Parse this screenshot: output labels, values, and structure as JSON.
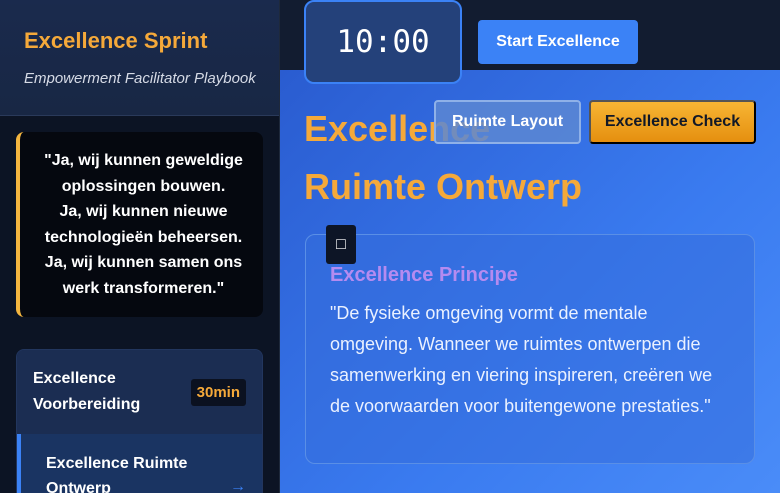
{
  "sidebar": {
    "title": "Excellence Sprint",
    "subtitle": "Empowerment Facilitator Playbook",
    "quote": "\"Ja, wij kunnen geweldige\noplossingen bouwen.\nJa, wij kunnen nieuwe\ntechnologieën beheersen.\nJa, wij kunnen samen ons\nwerk transformeren.\"",
    "agenda": {
      "header_label": "Excellence Voorbereiding",
      "header_duration": "30min",
      "active_item_label": "Excellence Ruimte Ontwerp",
      "active_item_arrow": "→"
    }
  },
  "topbar": {
    "timer": "10:00",
    "start_label": "Start Excellence"
  },
  "main": {
    "title": "Excellence Ruimte Ontwerp",
    "layout_button": "Ruimte Layout",
    "check_button": "Excellence Check",
    "principle": {
      "icon": "bulb-icon",
      "icon_glyph": "□",
      "title": "Excellence Principe",
      "text": "\"De fysieke omgeving vormt de mentale omgeving. Wanneer we ruimtes ontwerpen die samenwerking en viering inspireren, creëren we de voorwaarden voor buitengewone prestaties.\""
    }
  },
  "colors": {
    "accent_orange": "#f5a93a",
    "accent_blue": "#3b82f6",
    "accent_purple": "#b58bf0"
  }
}
